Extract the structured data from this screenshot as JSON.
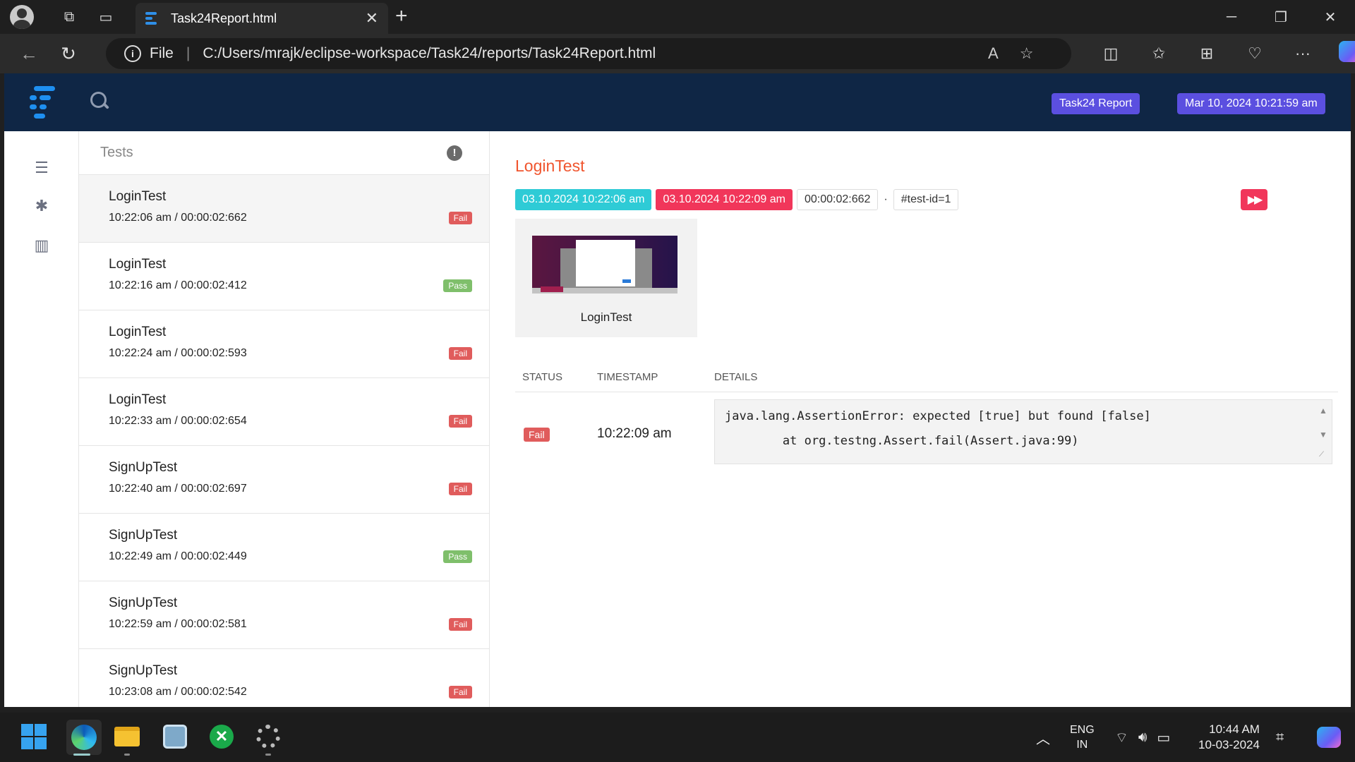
{
  "browser": {
    "tab_title": "Task24Report.html",
    "url_scheme": "File",
    "url": "C:/Users/mrajk/eclipse-workspace/Task24/reports/Task24Report.html"
  },
  "header": {
    "report_name": "Task24 Report",
    "report_date": "Mar 10, 2024 10:21:59 am"
  },
  "tests_panel": {
    "title": "Tests",
    "items": [
      {
        "name": "LoginTest",
        "meta": "10:22:06 am / 00:00:02:662",
        "status": "Fail"
      },
      {
        "name": "LoginTest",
        "meta": "10:22:16 am / 00:00:02:412",
        "status": "Pass"
      },
      {
        "name": "LoginTest",
        "meta": "10:22:24 am / 00:00:02:593",
        "status": "Fail"
      },
      {
        "name": "LoginTest",
        "meta": "10:22:33 am / 00:00:02:654",
        "status": "Fail"
      },
      {
        "name": "SignUpTest",
        "meta": "10:22:40 am / 00:00:02:697",
        "status": "Fail"
      },
      {
        "name": "SignUpTest",
        "meta": "10:22:49 am / 00:00:02:449",
        "status": "Pass"
      },
      {
        "name": "SignUpTest",
        "meta": "10:22:59 am / 00:00:02:581",
        "status": "Fail"
      },
      {
        "name": "SignUpTest",
        "meta": "10:23:08 am / 00:00:02:542",
        "status": "Fail"
      }
    ]
  },
  "detail": {
    "title": "LoginTest",
    "start": "03.10.2024 10:22:06 am",
    "end": "03.10.2024 10:22:09 am",
    "duration": "00:00:02:662",
    "separator": "·",
    "test_id": "#test-id=1",
    "screenshot_label": "LoginTest",
    "columns": {
      "status": "STATUS",
      "timestamp": "TIMESTAMP",
      "details": "DETAILS"
    },
    "log": {
      "status": "Fail",
      "timestamp": "10:22:09 am",
      "line1": "java.lang.AssertionError: expected [true] but found [false]",
      "line2": "\tat org.testng.Assert.fail(Assert.java:99)"
    }
  },
  "taskbar": {
    "lang_line1": "ENG",
    "lang_line2": "IN",
    "time": "10:44 AM",
    "date": "10-03-2024"
  },
  "colors": {
    "header_bg": "#0f2645",
    "accent_badge": "#5b4fe0",
    "title": "#f0552e",
    "fail": "#e05c5c",
    "pass": "#7fbf6b",
    "start_chip": "#2ecbd6",
    "end_chip": "#f1365a"
  }
}
